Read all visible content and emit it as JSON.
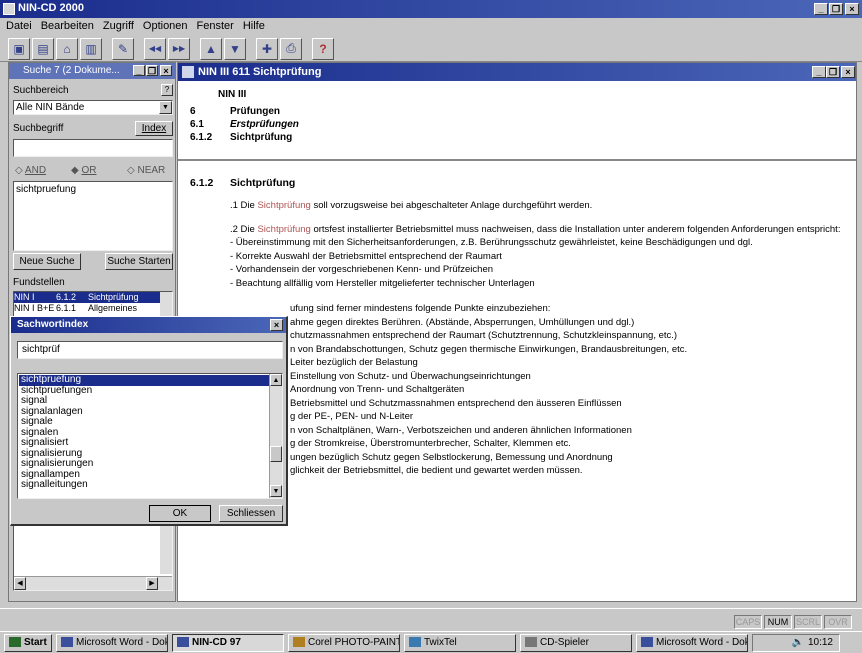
{
  "app": {
    "title": "NIN-CD 2000",
    "window_controls": [
      "_",
      "❐",
      "×"
    ]
  },
  "menu": [
    "Datei",
    "Bearbeiten",
    "Zugriff",
    "Optionen",
    "Fenster",
    "Hilfe"
  ],
  "toolbar": {
    "icons": [
      "browser-icon",
      "book-icon",
      "house-icon",
      "document-icon",
      "pen-icon",
      "back-icon",
      "forward-icon",
      "up-icon",
      "down-icon",
      "bookmark-icon",
      "print-icon",
      "help-icon"
    ],
    "glyphs": [
      "▣",
      "▤",
      "⌂",
      "▥",
      "✎",
      "◀◀",
      "▶▶",
      "▲",
      "▼",
      "✚",
      "⎙",
      "?"
    ]
  },
  "search_panel": {
    "title": "Suche 7 (2 Dokume...",
    "search_area_label": "Suchbereich",
    "search_area_value": "Alle NIN Bände",
    "term_label": "Suchbegriff",
    "index_button": "Index",
    "ops": {
      "and": "AND",
      "or": "OR",
      "near": "NEAR"
    },
    "query_text": "sichtpruefung",
    "new_search": "Neue Suche",
    "start_search": "Suche Starten",
    "results_label": "Fundstellen",
    "results": [
      {
        "doc": "NIN I",
        "num": "6.1.2",
        "title": "Sichtprüfung"
      },
      {
        "doc": "NIN I B+E",
        "num": "6.1.1",
        "title": "Allgemeines"
      }
    ]
  },
  "index_dialog": {
    "title": "Sachwortindex",
    "close_glyph": "×",
    "input_value": "sichtprüf",
    "items": [
      "sichtpruefung",
      "sichtpruefungen",
      "signal",
      "signalanlagen",
      "signale",
      "signalen",
      "signalisiert",
      "signalisierung",
      "signalisierungen",
      "signallampen",
      "signalleitungen"
    ],
    "ok_label": "OK",
    "close_label": "Schliessen"
  },
  "document": {
    "title": "NIN III   611 Sichtprüfung",
    "header": {
      "book": "NIN III",
      "rows": [
        {
          "num": "6",
          "text": "Prüfungen"
        },
        {
          "num": "6.1",
          "text": "Erstprüfungen"
        },
        {
          "num": "6.1.2",
          "text": "Sichtprüfung"
        }
      ]
    },
    "section_num": "6.1.2",
    "section_title": "Sichtprüfung",
    "p1_pre": ".1 Die ",
    "p1_hl": "Sichtprüfung",
    "p1_post": " soll vorzugsweise bei abgeschalteter Anlage durchgeführt werden.",
    "p2_pre": ".2 Die ",
    "p2_hl": "Sichtprüfung",
    "p2_post": " ortsfest installierter Betriebsmittel muss nachweisen, dass die Installation unter anderem folgenden Anforderungen entspricht:",
    "bullets_a": [
      "- Übereinstimmung mit den Sicherheitsanforderungen, z.B. Berührungsschutz gewährleistet, keine Beschädigungen und dgl.",
      "- Korrekte Auswahl der Betriebsmittel entsprechend der Raumart",
      "- Vorhandensein der vorgeschriebenen Kenn- und Prüfzeichen",
      "- Beachtung allfällig vom Hersteller mitgelieferter technischer Unterlagen"
    ],
    "p3_partial": "ufung sind ferner mindestens folgende Punkte einzubeziehen:",
    "partials": [
      "ahme gegen direktes Berühren. (Abstände, Absperrungen, Umhüllungen und dgl.)",
      "chutzmassnahmen entsprechend der Raumart (Schutztrennung, Schutzkleinspannung, etc.)",
      "n von Brandabschottungen, Schutz gegen thermische Einwirkungen, Brandausbreitungen, etc.",
      "Leiter bezüglich der Belastung",
      "Einstellung von Schutz- und Überwachungseinrichtungen",
      "Anordnung von Trenn- und Schaltgeräten",
      "Betriebsmittel und Schutzmassnahmen entsprechend den äusseren Einflüssen",
      "g der PE-, PEN- und N-Leiter",
      "n von Schaltplänen, Warn-, Verbotszeichen und anderen ähnlichen Informationen",
      "g der Stromkreise, Überstromunterbrecher, Schalter, Klemmen etc.",
      "ungen bezüglich Schutz gegen Selbstlockerung, Bemessung und Anordnung",
      "glichkeit der Betriebsmittel, die bedient und gewartet werden müssen."
    ]
  },
  "statusbar": {
    "caps": "CAPS",
    "num": "NUM",
    "scrl": "SCRL",
    "ovr": "OVR"
  },
  "taskbar": {
    "start": "Start",
    "tasks": [
      "Microsoft Word - Dok...",
      "NIN-CD 97",
      "Corel PHOTO-PAINT 8",
      "TwixTel",
      "CD-Spieler",
      "Microsoft Word - Dok..."
    ],
    "clock": "10:12"
  }
}
